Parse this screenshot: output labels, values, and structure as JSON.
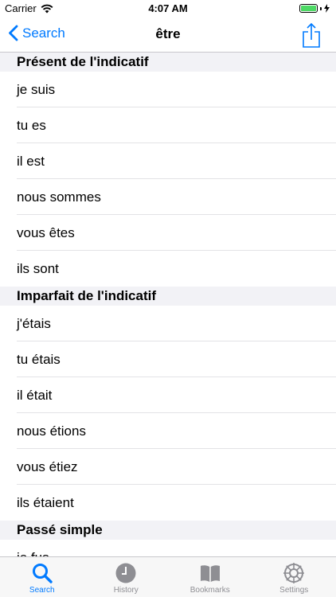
{
  "status": {
    "carrier": "Carrier",
    "time": "4:07 AM"
  },
  "nav": {
    "back_label": "Search",
    "title": "être"
  },
  "sections": [
    {
      "header": "Présent de l'indicatif",
      "rows": [
        "je suis",
        "tu es",
        "il est",
        "nous sommes",
        "vous êtes",
        "ils sont"
      ]
    },
    {
      "header": "Imparfait de l'indicatif",
      "rows": [
        "j'étais",
        "tu étais",
        "il était",
        "nous étions",
        "vous étiez",
        "ils étaient"
      ]
    },
    {
      "header": "Passé simple",
      "rows": [
        "je fus"
      ]
    }
  ],
  "tabs": [
    {
      "label": "Search",
      "icon": "search-icon",
      "active": true
    },
    {
      "label": "History",
      "icon": "clock-icon",
      "active": false
    },
    {
      "label": "Bookmarks",
      "icon": "book-icon",
      "active": false
    },
    {
      "label": "Settings",
      "icon": "gear-icon",
      "active": false
    }
  ],
  "colors": {
    "accent": "#007aff",
    "inactive": "#8e8e93",
    "battery": "#4cd964"
  }
}
